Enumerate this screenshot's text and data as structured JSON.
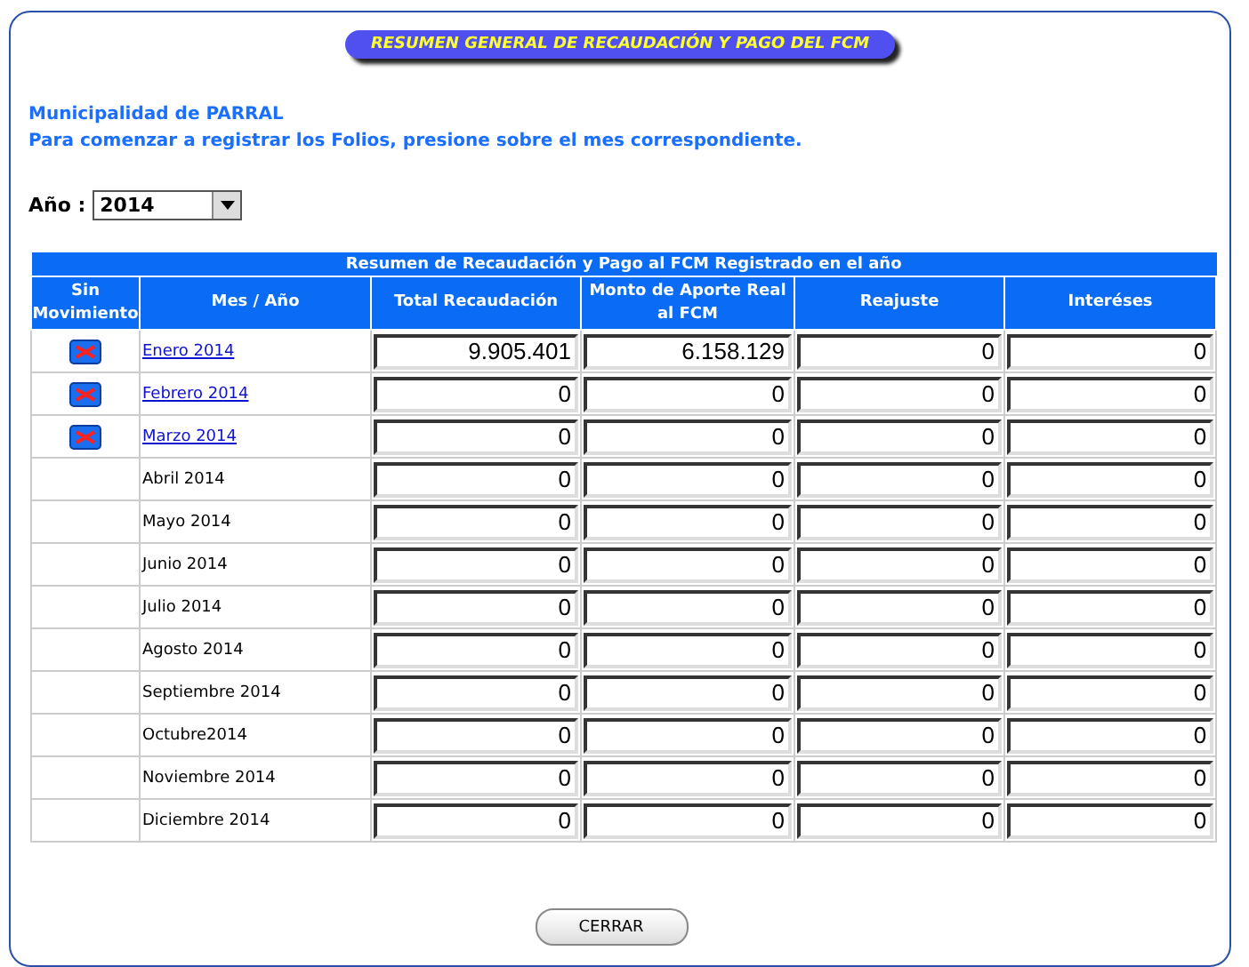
{
  "title": "RESUMEN GENERAL DE RECAUDACIÓN Y PAGO DEL FCM",
  "municipality": "Municipalidad de PARRAL",
  "instructions": "Para comenzar a registrar los Folios, presione sobre el mes correspondiente.",
  "year_label": "Año :",
  "year_value": "2014",
  "table": {
    "caption": "Resumen de Recaudación y Pago al FCM Registrado en el año",
    "columns": [
      "Sin Movimiento",
      "Mes / Año",
      "Total Recaudación",
      "Monto de Aporte Real al FCM",
      "Reajuste",
      "Interéses"
    ],
    "rows": [
      {
        "month": "Enero 2014",
        "linked": true,
        "values": [
          "9.905.401",
          "6.158.129",
          "0",
          "0"
        ]
      },
      {
        "month": "Febrero 2014",
        "linked": true,
        "values": [
          "0",
          "0",
          "0",
          "0"
        ]
      },
      {
        "month": "Marzo 2014",
        "linked": true,
        "values": [
          "0",
          "0",
          "0",
          "0"
        ]
      },
      {
        "month": "Abril 2014",
        "linked": false,
        "values": [
          "0",
          "0",
          "0",
          "0"
        ]
      },
      {
        "month": "Mayo 2014",
        "linked": false,
        "values": [
          "0",
          "0",
          "0",
          "0"
        ]
      },
      {
        "month": "Junio 2014",
        "linked": false,
        "values": [
          "0",
          "0",
          "0",
          "0"
        ]
      },
      {
        "month": "Julio 2014",
        "linked": false,
        "values": [
          "0",
          "0",
          "0",
          "0"
        ]
      },
      {
        "month": "Agosto 2014",
        "linked": false,
        "values": [
          "0",
          "0",
          "0",
          "0"
        ]
      },
      {
        "month": "Septiembre 2014",
        "linked": false,
        "values": [
          "0",
          "0",
          "0",
          "0"
        ]
      },
      {
        "month": "Octubre2014",
        "linked": false,
        "values": [
          "0",
          "0",
          "0",
          "0"
        ]
      },
      {
        "month": "Noviembre 2014",
        "linked": false,
        "values": [
          "0",
          "0",
          "0",
          "0"
        ]
      },
      {
        "month": "Diciembre 2014",
        "linked": false,
        "values": [
          "0",
          "0",
          "0",
          "0"
        ]
      }
    ]
  },
  "close_button": "CERRAR"
}
